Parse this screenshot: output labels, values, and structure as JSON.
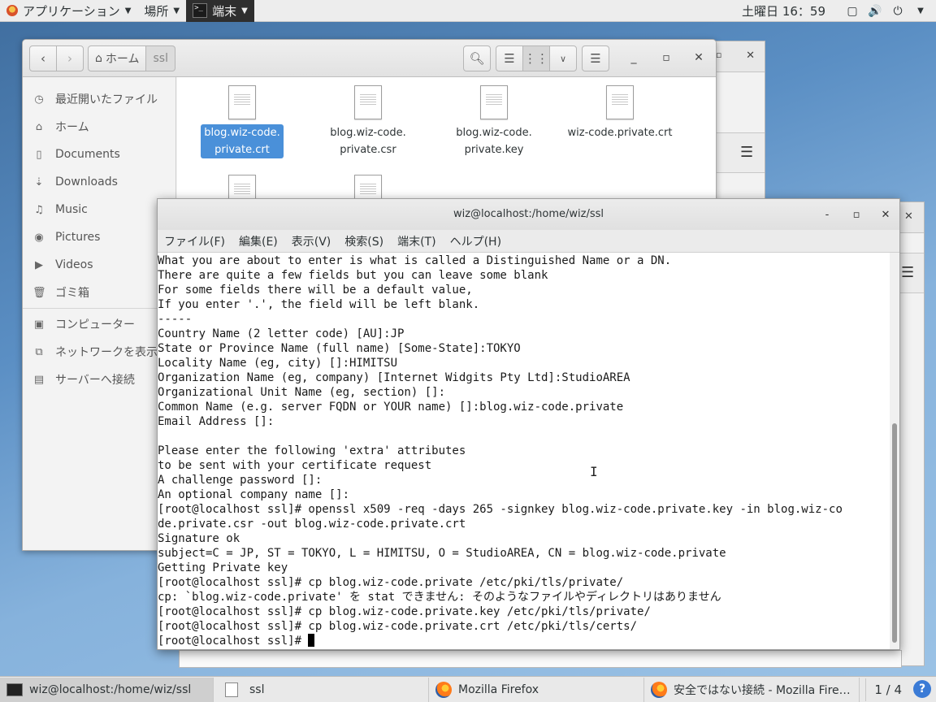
{
  "topbar": {
    "applications": "アプリケーション",
    "places": "場所",
    "terminal": "端末",
    "clock": "土曜日 16：59"
  },
  "files": {
    "crumb_home": "ホーム",
    "crumb_current": "ssl",
    "sidebar": [
      {
        "icon": "clock-icon",
        "label": "最近開いたファイル"
      },
      {
        "icon": "home-icon",
        "label": "ホーム"
      },
      {
        "icon": "document-icon",
        "label": "Documents"
      },
      {
        "icon": "download-icon",
        "label": "Downloads"
      },
      {
        "icon": "music-icon",
        "label": "Music"
      },
      {
        "icon": "camera-icon",
        "label": "Pictures"
      },
      {
        "icon": "video-icon",
        "label": "Videos"
      },
      {
        "icon": "trash-icon",
        "label": "ゴミ箱"
      },
      {
        "icon": "computer-icon",
        "label": "コンピューター"
      },
      {
        "icon": "network-icon",
        "label": "ネットワークを表示"
      },
      {
        "icon": "server-icon",
        "label": "サーバーへ接続"
      }
    ],
    "items": [
      {
        "line1": "blog.wiz-code.",
        "line2": "private.crt",
        "selected": true
      },
      {
        "line1": "blog.wiz-code.",
        "line2": "private.csr"
      },
      {
        "line1": "blog.wiz-code.",
        "line2": "private.key"
      },
      {
        "line1": "wiz-code.private.crt",
        "line2": ""
      }
    ]
  },
  "terminal": {
    "title": "wiz@localhost:/home/wiz/ssl",
    "menu": [
      "ファイル(F)",
      "編集(E)",
      "表示(V)",
      "検索(S)",
      "端末(T)",
      "ヘルプ(H)"
    ],
    "lines": [
      "What you are about to enter is what is called a Distinguished Name or a DN.",
      "There are quite a few fields but you can leave some blank",
      "For some fields there will be a default value,",
      "If you enter '.', the field will be left blank.",
      "-----",
      "Country Name (2 letter code) [AU]:JP",
      "State or Province Name (full name) [Some-State]:TOKYO",
      "Locality Name (eg, city) []:HIMITSU",
      "Organization Name (eg, company) [Internet Widgits Pty Ltd]:StudioAREA",
      "Organizational Unit Name (eg, section) []:",
      "Common Name (e.g. server FQDN or YOUR name) []:blog.wiz-code.private",
      "Email Address []:",
      "",
      "Please enter the following 'extra' attributes",
      "to be sent with your certificate request",
      "A challenge password []:",
      "An optional company name []:",
      "[root@localhost ssl]# openssl x509 -req -days 265 -signkey blog.wiz-code.private.key -in blog.wiz-co",
      "de.private.csr -out blog.wiz-code.private.crt",
      "Signature ok",
      "subject=C = JP, ST = TOKYO, L = HIMITSU, O = StudioAREA, CN = blog.wiz-code.private",
      "Getting Private key",
      "[root@localhost ssl]# cp blog.wiz-code.private /etc/pki/tls/private/",
      "cp: `blog.wiz-code.private' を stat できません: そのようなファイルやディレクトリはありません",
      "[root@localhost ssl]# cp blog.wiz-code.private.key /etc/pki/tls/private/",
      "[root@localhost ssl]# cp blog.wiz-code.private.crt /etc/pki/tls/certs/",
      "[root@localhost ssl]# "
    ]
  },
  "taskbar": {
    "tasks": [
      "wiz@localhost:/home/wiz/ssl",
      "ssl",
      "Mozilla Firefox",
      "安全ではない接続 - Mozilla Fire…"
    ],
    "pager": "1 / 4"
  }
}
